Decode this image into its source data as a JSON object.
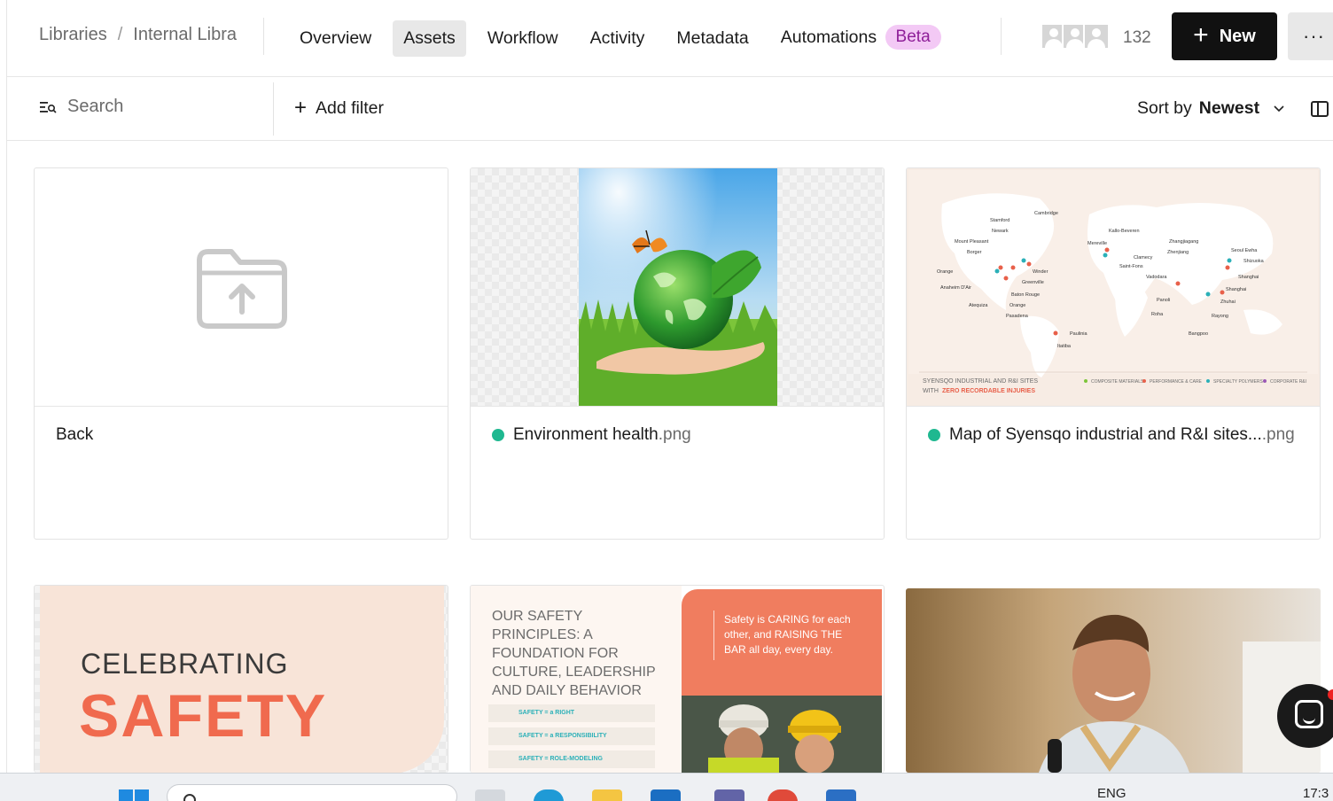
{
  "breadcrumb": {
    "root": "Libraries",
    "separator": "/",
    "current": "Internal Libra"
  },
  "tabs": [
    {
      "label": "Overview",
      "active": false
    },
    {
      "label": "Assets",
      "active": true
    },
    {
      "label": "Workflow",
      "active": false
    },
    {
      "label": "Activity",
      "active": false
    },
    {
      "label": "Metadata",
      "active": false
    },
    {
      "label": "Automations",
      "active": false
    }
  ],
  "beta_badge": "Beta",
  "members": {
    "count": "132"
  },
  "header": {
    "new_label": "New",
    "more_label": "···"
  },
  "filters": {
    "search_label": "Search",
    "add_filter_label": "Add filter",
    "sort_prefix": "Sort by",
    "sort_value": "Newest"
  },
  "assets": [
    {
      "type": "folder",
      "label": "Back"
    },
    {
      "type": "file",
      "name": "Environment health",
      "ext": ".png"
    },
    {
      "type": "file",
      "name": "Map of Syensqo industrial and R&I sites...",
      "ext": ".png"
    }
  ],
  "thumbnails": {
    "map_title": "SYENSQO INDUSTRIAL AND R&I SITES",
    "map_subtitle_prefix": "WITH",
    "map_subtitle_highlight": "ZERO RECORDABLE INJURIES",
    "map_legend": [
      "COMPOSITE MATERIALS",
      "PERFORMANCE & CARE",
      "SPECIALTY POLYMERS",
      "CORPORATE R&I"
    ],
    "map_cities": [
      "Stamford",
      "Newark",
      "Mount Pleasant",
      "Borger",
      "Orange",
      "Anaheim D'Air",
      "Atequiza",
      "Cambridge",
      "Winder",
      "Greenville",
      "Baton Rouge",
      "Orange",
      "Pasadena",
      "Paulinia",
      "Itatiba",
      "Kallo-Beveren",
      "Mereville",
      "Clamecy",
      "Saint-Fons",
      "Vadodara",
      "Panoli",
      "Roha",
      "Zhangjiagang",
      "Zhenjiang",
      "Seoul Ewha",
      "Shizuoka",
      "Shanghai",
      "Shanghai",
      "Zhuhai",
      "Rayong",
      "Bangpoo"
    ],
    "celebrating_line1": "CELEBRATING",
    "celebrating_line2": "SAFETY",
    "principles_heading": "OUR SAFETY PRINCIPLES: A FOUNDATION FOR CULTURE, LEADERSHIP AND DAILY BEHAVIOR",
    "principles_orange_text": "Safety is CARING for each other, and RAISING THE BAR all day, every day.",
    "principles_list": [
      "SAFETY = a RIGHT",
      "SAFETY = a RESPONSIBILITY",
      "SAFETY = ROLE-MODELING"
    ]
  },
  "taskbar": {
    "language": "ENG",
    "time": "17:3"
  },
  "colors": {
    "status_green": "#1fb890",
    "accent_orange": "#f06a4e",
    "beta_bg": "#f3c9f5",
    "beta_text": "#8f1f99"
  }
}
